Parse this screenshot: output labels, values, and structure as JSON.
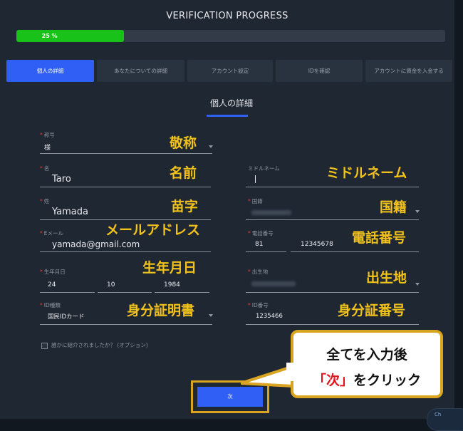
{
  "header": {
    "title": "VERIFICATION PROGRESS"
  },
  "progress": {
    "percent_label": "25 %",
    "value_percent": 25
  },
  "tabs": [
    {
      "label": "個人の詳細",
      "active": true
    },
    {
      "label": "あなたについての詳細",
      "active": false
    },
    {
      "label": "アカウント設定",
      "active": false
    },
    {
      "label": "IDを確認",
      "active": false
    },
    {
      "label": "アカウントに資金を入金する",
      "active": false
    }
  ],
  "section": {
    "title": "個人の詳細"
  },
  "form": {
    "required_mark": "*",
    "salutation": {
      "label": "称号",
      "value": "様",
      "annotation": "敬称"
    },
    "middle_name": {
      "label": "ミドルネーム",
      "value": "",
      "annotation": "ミドルネーム"
    },
    "first_name": {
      "label": "名",
      "value": "Taro",
      "annotation": "名前"
    },
    "nationality": {
      "label": "国籍",
      "annotation": "国籍"
    },
    "last_name": {
      "label": "姓",
      "value": "Yamada",
      "annotation": "苗字"
    },
    "email": {
      "label": "Eメール",
      "value": "yamada@gmail.com",
      "annotation": "メールアドレス"
    },
    "phone": {
      "label": "電話番号",
      "country_code": "81",
      "number": "12345678",
      "annotation": "電話番号"
    },
    "birth_date": {
      "label": "生年月日",
      "day": "24",
      "month": "10",
      "year": "1984",
      "annotation": "生年月日"
    },
    "birthplace": {
      "label": "出生地",
      "annotation": "出生地"
    },
    "id_type": {
      "label": "ID種類",
      "value": "国民IDカード",
      "annotation": "身分証明書"
    },
    "id_number": {
      "label": "ID番号",
      "value": "1235466",
      "annotation": "身分証番号"
    },
    "referral_label": "誰かに紹介されましたか？ (オプション)"
  },
  "next_button": {
    "label": "次"
  },
  "callout": {
    "line1": "全てを入力後",
    "line2_highlight": "「次」",
    "line2_rest": "をクリック"
  },
  "chat": {
    "label": "Ch"
  },
  "colors": {
    "accent": "#2f5ff5",
    "progress": "#19c219",
    "annotation": "#f1c21b",
    "required": "#e23b3b"
  }
}
